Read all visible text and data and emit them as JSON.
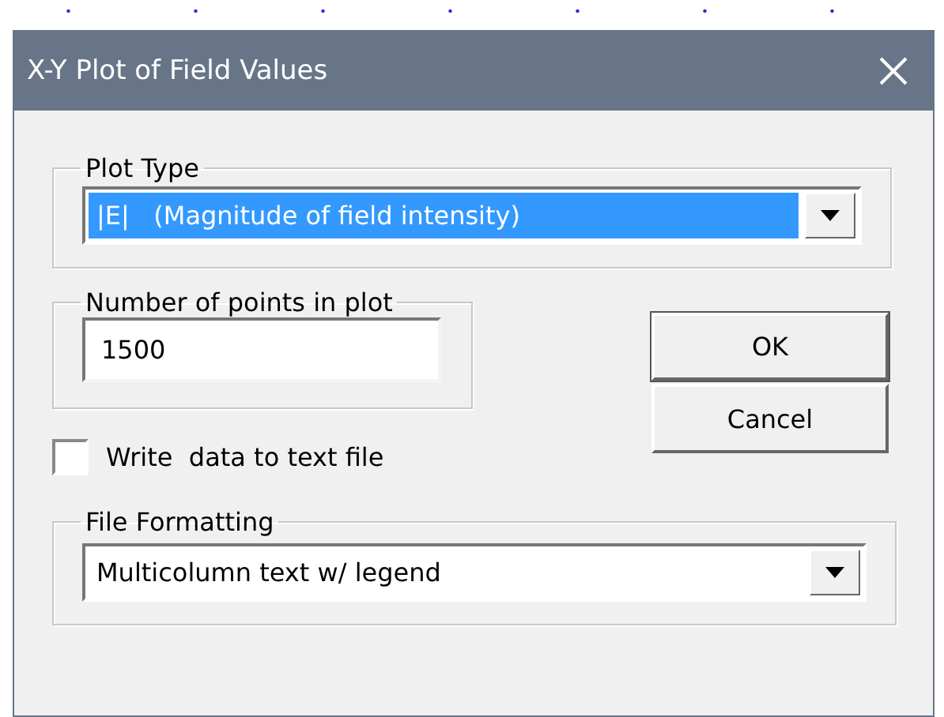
{
  "window": {
    "title": "X-Y Plot of Field Values"
  },
  "plot_type": {
    "label": "Plot Type",
    "value": "|E|   (Magnitude of field intensity)",
    "focused": true
  },
  "points": {
    "label": "Number of points in plot",
    "value": "1500"
  },
  "buttons": [
    {
      "label": "OK",
      "default": true
    },
    {
      "label": "Cancel",
      "default": false
    }
  ],
  "write_file": {
    "label": "Write  data to text file",
    "checked": false
  },
  "file_formatting": {
    "label": "File Formatting",
    "value": "Multicolumn text w/ legend",
    "focused": false
  }
}
